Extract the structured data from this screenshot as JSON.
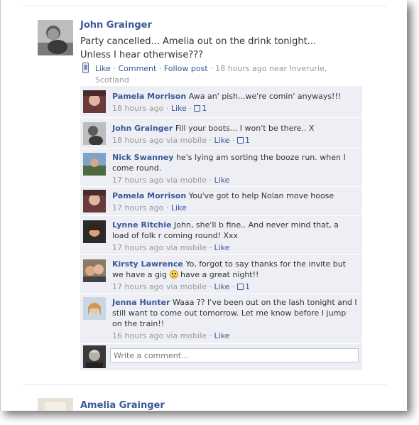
{
  "post": {
    "author": "John Grainger",
    "text": "Party cancelled... Amelia out on the drink tonight... Unless I hear otherwise???",
    "actions": {
      "like": "Like",
      "comment": "Comment",
      "follow": "Follow post"
    },
    "separator": "·",
    "timestamp": "18 hours ago near Inverurie, Scotland"
  },
  "comments": [
    {
      "author": "Pamela Morrison",
      "text": "Awa an' pish...we're comin' anyways!!!",
      "time": "18 hours ago",
      "via": "",
      "like": "Like",
      "likes": "1"
    },
    {
      "author": "John Grainger",
      "text": "Fill your boots... I won't be there.. X",
      "time": "18 hours ago",
      "via": "via mobile",
      "like": "Like",
      "likes": "1"
    },
    {
      "author": "Nick Swanney",
      "text": "he's lying am sorting the booze run. when I come round.",
      "time": "17 hours ago",
      "via": "via mobile",
      "like": "Like",
      "likes": ""
    },
    {
      "author": "Pamela Morrison",
      "text": "You've got to help Nolan move hoose",
      "time": "17 hours ago",
      "via": "",
      "like": "Like",
      "likes": ""
    },
    {
      "author": "Lynne Ritchie",
      "text": "John, she'll b fine.. And never mind that, a load of folk r coming round! Xxx",
      "time": "17 hours ago",
      "via": "via mobile",
      "like": "Like",
      "likes": ""
    },
    {
      "author": "Kirsty Lawrence",
      "text_before": "Yo, forgot to say thanks for the invite but we have a gig",
      "text_after": "have a great night!!",
      "emoticon": "sad-face",
      "time": "17 hours ago",
      "via": "via mobile",
      "like": "Like",
      "likes": "1"
    },
    {
      "author": "Jenna Hunter",
      "text": "Waaa ?? I've been out on the lash tonight and I still want to come out tomorrow. Let me know before I jump on the train!!",
      "time": "16 hours ago",
      "via": "via mobile",
      "like": "Like",
      "likes": ""
    }
  ],
  "composer": {
    "placeholder": "Write a comment..."
  },
  "next_post": {
    "author": "Amelia Grainger"
  },
  "colors": {
    "link": "#3b5998",
    "comment_bg": "#edeff4",
    "meta": "#999999"
  }
}
